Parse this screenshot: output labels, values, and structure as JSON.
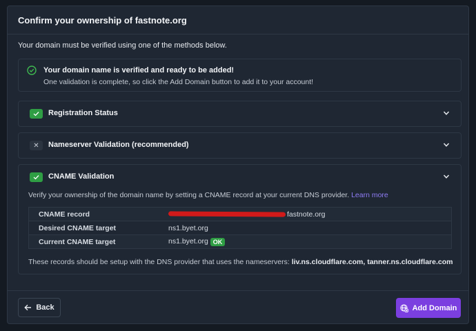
{
  "header": {
    "title": "Confirm your ownership of fastnote.org"
  },
  "intro": "Your domain must be verified using one of the methods below.",
  "notice": {
    "title": "Your domain name is verified and ready to be added!",
    "message": "One validation is complete, so click the Add Domain button to add it to your account!",
    "icon": "check-circle-icon",
    "color": "#2f9e44"
  },
  "panels": [
    {
      "title": "Registration Status",
      "status": "ok"
    },
    {
      "title": "Nameserver Validation (recommended)",
      "status": "fail"
    },
    {
      "title": "CNAME Validation",
      "status": "ok"
    }
  ],
  "cname": {
    "description": "Verify your ownership of the domain name by setting a CNAME record at your current DNS provider.",
    "learn_more": "Learn more",
    "rows": [
      {
        "label": "CNAME record",
        "value": "fastnote.org"
      },
      {
        "label": "Desired CNAME target",
        "value": "ns1.byet.org"
      },
      {
        "label": "Current CNAME target",
        "value": "ns1.byet.org",
        "badge": "OK"
      }
    ],
    "ns_note_prefix": "These records should be setup with the DNS provider that uses the nameservers:",
    "ns_note_servers": "liv.ns.cloudflare.com, tanner.ns.cloudflare.com"
  },
  "footer": {
    "back_label": "Back",
    "add_label": "Add Domain"
  },
  "colors": {
    "accent": "#7b3fe0",
    "success": "#2f9e44",
    "link": "#8f7cf5"
  }
}
